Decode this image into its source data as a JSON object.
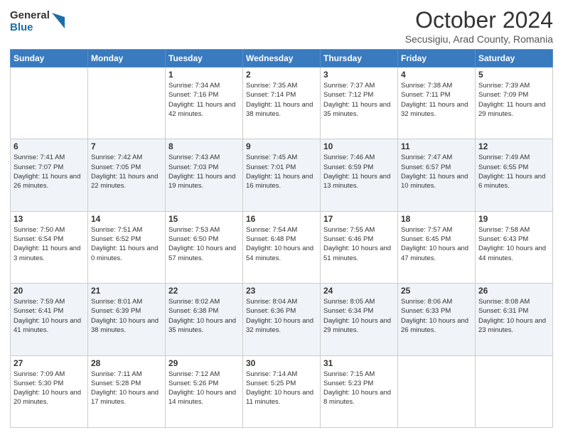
{
  "header": {
    "logo_general": "General",
    "logo_blue": "Blue",
    "title": "October 2024",
    "location": "Secusigiu, Arad County, Romania"
  },
  "weekdays": [
    "Sunday",
    "Monday",
    "Tuesday",
    "Wednesday",
    "Thursday",
    "Friday",
    "Saturday"
  ],
  "rows": [
    [
      {
        "day": "",
        "info": ""
      },
      {
        "day": "",
        "info": ""
      },
      {
        "day": "1",
        "info": "Sunrise: 7:34 AM\nSunset: 7:16 PM\nDaylight: 11 hours and 42 minutes."
      },
      {
        "day": "2",
        "info": "Sunrise: 7:35 AM\nSunset: 7:14 PM\nDaylight: 11 hours and 38 minutes."
      },
      {
        "day": "3",
        "info": "Sunrise: 7:37 AM\nSunset: 7:12 PM\nDaylight: 11 hours and 35 minutes."
      },
      {
        "day": "4",
        "info": "Sunrise: 7:38 AM\nSunset: 7:11 PM\nDaylight: 11 hours and 32 minutes."
      },
      {
        "day": "5",
        "info": "Sunrise: 7:39 AM\nSunset: 7:09 PM\nDaylight: 11 hours and 29 minutes."
      }
    ],
    [
      {
        "day": "6",
        "info": "Sunrise: 7:41 AM\nSunset: 7:07 PM\nDaylight: 11 hours and 26 minutes."
      },
      {
        "day": "7",
        "info": "Sunrise: 7:42 AM\nSunset: 7:05 PM\nDaylight: 11 hours and 22 minutes."
      },
      {
        "day": "8",
        "info": "Sunrise: 7:43 AM\nSunset: 7:03 PM\nDaylight: 11 hours and 19 minutes."
      },
      {
        "day": "9",
        "info": "Sunrise: 7:45 AM\nSunset: 7:01 PM\nDaylight: 11 hours and 16 minutes."
      },
      {
        "day": "10",
        "info": "Sunrise: 7:46 AM\nSunset: 6:59 PM\nDaylight: 11 hours and 13 minutes."
      },
      {
        "day": "11",
        "info": "Sunrise: 7:47 AM\nSunset: 6:57 PM\nDaylight: 11 hours and 10 minutes."
      },
      {
        "day": "12",
        "info": "Sunrise: 7:49 AM\nSunset: 6:55 PM\nDaylight: 11 hours and 6 minutes."
      }
    ],
    [
      {
        "day": "13",
        "info": "Sunrise: 7:50 AM\nSunset: 6:54 PM\nDaylight: 11 hours and 3 minutes."
      },
      {
        "day": "14",
        "info": "Sunrise: 7:51 AM\nSunset: 6:52 PM\nDaylight: 11 hours and 0 minutes."
      },
      {
        "day": "15",
        "info": "Sunrise: 7:53 AM\nSunset: 6:50 PM\nDaylight: 10 hours and 57 minutes."
      },
      {
        "day": "16",
        "info": "Sunrise: 7:54 AM\nSunset: 6:48 PM\nDaylight: 10 hours and 54 minutes."
      },
      {
        "day": "17",
        "info": "Sunrise: 7:55 AM\nSunset: 6:46 PM\nDaylight: 10 hours and 51 minutes."
      },
      {
        "day": "18",
        "info": "Sunrise: 7:57 AM\nSunset: 6:45 PM\nDaylight: 10 hours and 47 minutes."
      },
      {
        "day": "19",
        "info": "Sunrise: 7:58 AM\nSunset: 6:43 PM\nDaylight: 10 hours and 44 minutes."
      }
    ],
    [
      {
        "day": "20",
        "info": "Sunrise: 7:59 AM\nSunset: 6:41 PM\nDaylight: 10 hours and 41 minutes."
      },
      {
        "day": "21",
        "info": "Sunrise: 8:01 AM\nSunset: 6:39 PM\nDaylight: 10 hours and 38 minutes."
      },
      {
        "day": "22",
        "info": "Sunrise: 8:02 AM\nSunset: 6:38 PM\nDaylight: 10 hours and 35 minutes."
      },
      {
        "day": "23",
        "info": "Sunrise: 8:04 AM\nSunset: 6:36 PM\nDaylight: 10 hours and 32 minutes."
      },
      {
        "day": "24",
        "info": "Sunrise: 8:05 AM\nSunset: 6:34 PM\nDaylight: 10 hours and 29 minutes."
      },
      {
        "day": "25",
        "info": "Sunrise: 8:06 AM\nSunset: 6:33 PM\nDaylight: 10 hours and 26 minutes."
      },
      {
        "day": "26",
        "info": "Sunrise: 8:08 AM\nSunset: 6:31 PM\nDaylight: 10 hours and 23 minutes."
      }
    ],
    [
      {
        "day": "27",
        "info": "Sunrise: 7:09 AM\nSunset: 5:30 PM\nDaylight: 10 hours and 20 minutes."
      },
      {
        "day": "28",
        "info": "Sunrise: 7:11 AM\nSunset: 5:28 PM\nDaylight: 10 hours and 17 minutes."
      },
      {
        "day": "29",
        "info": "Sunrise: 7:12 AM\nSunset: 5:26 PM\nDaylight: 10 hours and 14 minutes."
      },
      {
        "day": "30",
        "info": "Sunrise: 7:14 AM\nSunset: 5:25 PM\nDaylight: 10 hours and 11 minutes."
      },
      {
        "day": "31",
        "info": "Sunrise: 7:15 AM\nSunset: 5:23 PM\nDaylight: 10 hours and 8 minutes."
      },
      {
        "day": "",
        "info": ""
      },
      {
        "day": "",
        "info": ""
      }
    ]
  ]
}
